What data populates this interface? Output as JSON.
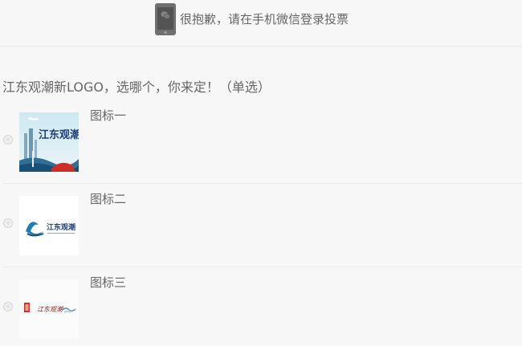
{
  "banner": {
    "icon": "phone-wechat-icon",
    "message": "很抱歉，请在手机微信登录投票"
  },
  "question": {
    "title": "江东观潮新LOGO，选哪个，你来定！（单选）"
  },
  "options": [
    {
      "label": "图标一",
      "logo_text": "江东观潮",
      "selected": false
    },
    {
      "label": "图标二",
      "logo_text": "江东观潮",
      "selected": false
    },
    {
      "label": "图标三",
      "logo_text": "江东观潮",
      "selected": false
    }
  ],
  "colors": {
    "background": "#f7f7f7",
    "text": "#666666",
    "divider": "#ebebeb",
    "logo_blue": "#1f3f74",
    "seal_red": "#c0392b"
  }
}
